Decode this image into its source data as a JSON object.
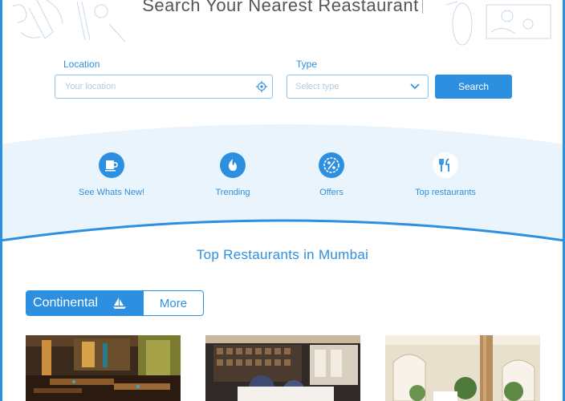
{
  "hero": {
    "title": "Search Your Nearest Reastaurant"
  },
  "search": {
    "location_label": "Location",
    "location_placeholder": "Your location",
    "type_label": "Type",
    "type_placeholder": "Select type",
    "button_label": "Search"
  },
  "features": [
    {
      "label": "See Whats New!",
      "icon": "cup-icon"
    },
    {
      "label": "Trending",
      "icon": "flame-icon"
    },
    {
      "label": "Offers",
      "icon": "percent-badge-icon"
    },
    {
      "label": "Top restaurants",
      "icon": "fork-knife-icon"
    }
  ],
  "section": {
    "title": "Top Restaurants in Mumbai"
  },
  "category_toggle": {
    "active_label": "Continental",
    "more_label": "More"
  },
  "colors": {
    "accent": "#2d8fe0",
    "band": "#eaf4fc"
  }
}
